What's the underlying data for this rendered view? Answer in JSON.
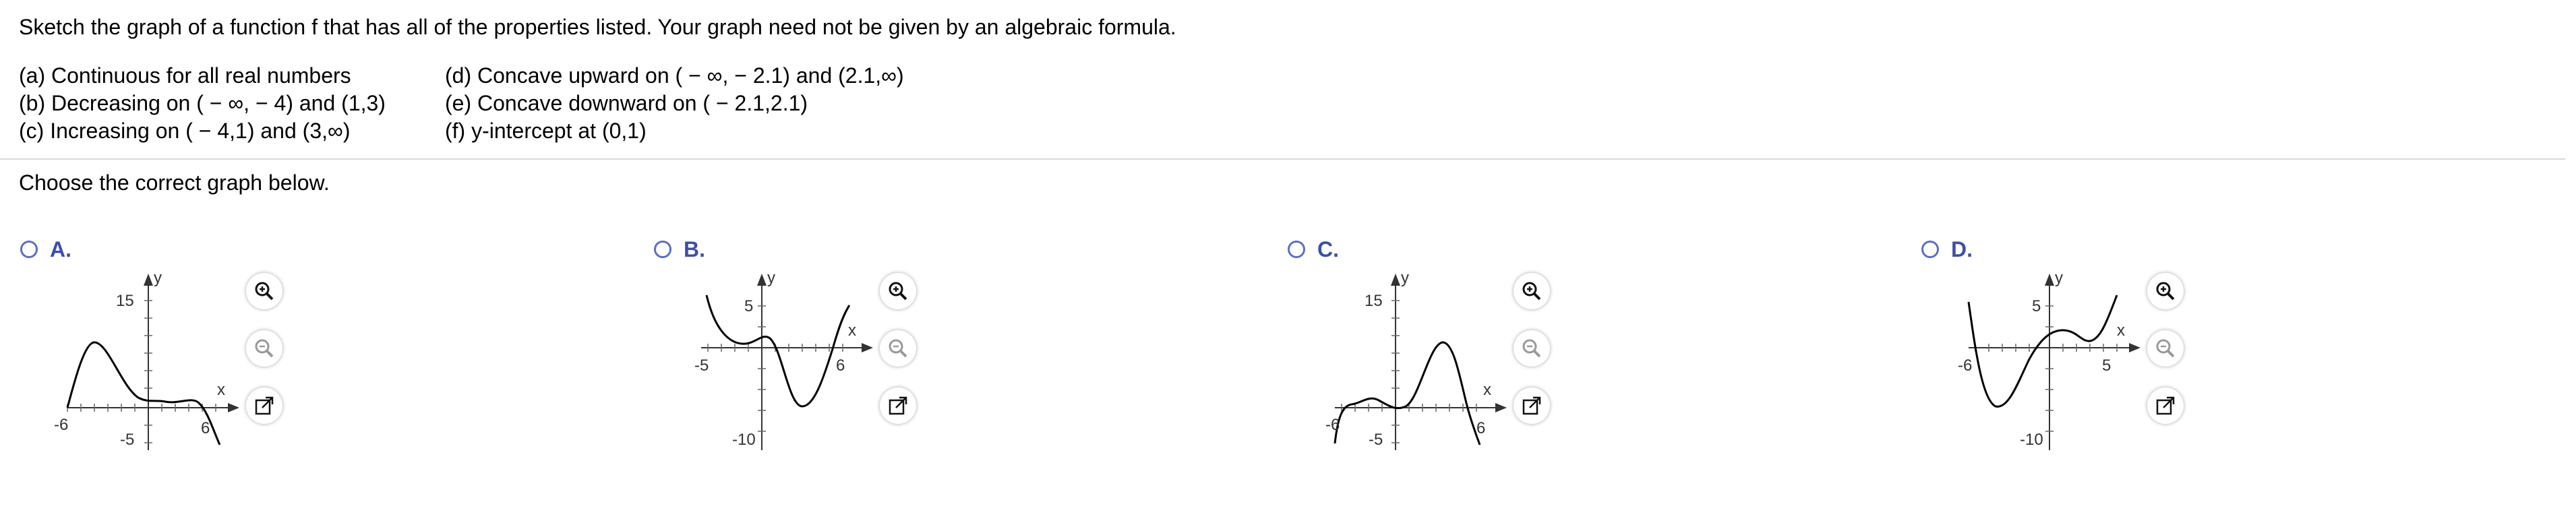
{
  "question": {
    "prompt": "Sketch the graph of a function f that has all of the properties listed. Your graph need not be given by an algebraic formula.",
    "properties_left": [
      "(a) Continuous for all real numbers",
      "(b) Decreasing on ( − ∞, − 4) and (1,3)",
      "(c) Increasing on ( − 4,1) and (3,∞)"
    ],
    "properties_right": [
      "(d) Concave upward on ( − ∞, − 2.1) and (2.1,∞)",
      "(e) Concave downward on ( − 2.1,2.1)",
      "(f) y-intercept at (0,1)"
    ],
    "instruction": "Choose the correct graph below."
  },
  "options": [
    {
      "label": "A.",
      "axis_x_label": "x",
      "axis_y_label": "y",
      "tick_labels": {
        "x_min": "-6",
        "x_max": "6",
        "y_max": "15",
        "y_min": "-5"
      },
      "selected": false
    },
    {
      "label": "B.",
      "axis_x_label": "x",
      "axis_y_label": "y",
      "tick_labels": {
        "x_min": "-5",
        "x_max": "6",
        "y_max": "5",
        "y_min": "-10"
      },
      "selected": false
    },
    {
      "label": "C.",
      "axis_x_label": "x",
      "axis_y_label": "y",
      "tick_labels": {
        "x_min": "-6",
        "x_max": "6",
        "y_max": "15",
        "y_min": "-5"
      },
      "selected": false
    },
    {
      "label": "D.",
      "axis_x_label": "x",
      "axis_y_label": "y",
      "tick_labels": {
        "x_min": "-6",
        "x_max": "5",
        "y_max": "5",
        "y_min": "-10"
      },
      "selected": false
    }
  ],
  "tools": [
    "zoom-in-icon",
    "zoom-out-icon",
    "open-external-icon"
  ],
  "colors": {
    "accent": "#3d4fa8",
    "radio": "#5b6fc4",
    "divider": "#d9d9d9"
  }
}
